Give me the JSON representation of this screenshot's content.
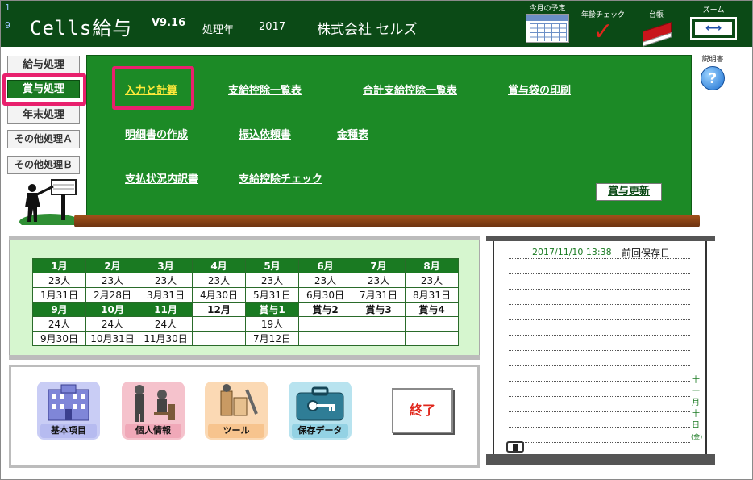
{
  "header": {
    "num_top": "1",
    "num_bottom": "9",
    "app_title": "Cells給与",
    "version": "V9.16",
    "year_label": "処理年",
    "year_value": "2017",
    "company": "株式会社 セルズ",
    "tools": {
      "calendar_label": "今月の予定",
      "age_check_label": "年齢チェック",
      "ledger_label": "台帳",
      "zoom_label": "ズーム"
    }
  },
  "left_menu": {
    "items": [
      {
        "label": "給与処理",
        "active": false
      },
      {
        "label": "賞与処理",
        "active": true
      },
      {
        "label": "年末処理",
        "active": false
      },
      {
        "label": "その他処理Ａ",
        "active": false
      },
      {
        "label": "その他処理Ｂ",
        "active": false
      }
    ]
  },
  "help": {
    "label": "説明書",
    "icon": "?"
  },
  "board": {
    "links": [
      {
        "label": "入力と計算",
        "highlight": true
      },
      {
        "label": "支給控除一覧表"
      },
      {
        "label": "合計支給控除一覧表"
      },
      {
        "label": "賞与袋の印刷"
      },
      {
        "label": "明細書の作成"
      },
      {
        "label": "振込依頼書"
      },
      {
        "label": "金種表"
      },
      {
        "label": "支払状況内訳書"
      },
      {
        "label": "支給控除チェック"
      }
    ],
    "update_button": "賞与更新"
  },
  "calendar": {
    "row1_months": [
      "1月",
      "2月",
      "3月",
      "4月",
      "5月",
      "6月",
      "7月",
      "8月"
    ],
    "row1_counts": [
      "23人",
      "23人",
      "23人",
      "23人",
      "23人",
      "23人",
      "23人",
      "23人"
    ],
    "row1_dates": [
      "1月31日",
      "2月28日",
      "3月31日",
      "4月30日",
      "5月31日",
      "6月30日",
      "7月31日",
      "8月31日"
    ],
    "row2_months": [
      "9月",
      "10月",
      "11月",
      "12月",
      "賞与1",
      "賞与2",
      "賞与3",
      "賞与4"
    ],
    "row2_counts": [
      "24人",
      "24人",
      "24人",
      "",
      "19人",
      "",
      "",
      ""
    ],
    "row2_dates": [
      "9月30日",
      "10月31日",
      "11月30日",
      "",
      "7月12日",
      "",
      "",
      ""
    ]
  },
  "bottom_buttons": {
    "basic": "基本項目",
    "personal": "個人情報",
    "tools": "ツール",
    "save": "保存データ",
    "exit": "終了"
  },
  "notepad": {
    "saved_date": "2017/11/10 13:38",
    "saved_label": "前回保存日",
    "vertical_date": [
      "十",
      "一",
      "月",
      "十",
      "日",
      "(金)"
    ]
  },
  "colors": {
    "header_bg": "#0b4a16",
    "board_bg": "#1c8a26",
    "active_menu": "#1a7a22",
    "highlight": "#e8206d",
    "exit_text": "#e0261b"
  }
}
